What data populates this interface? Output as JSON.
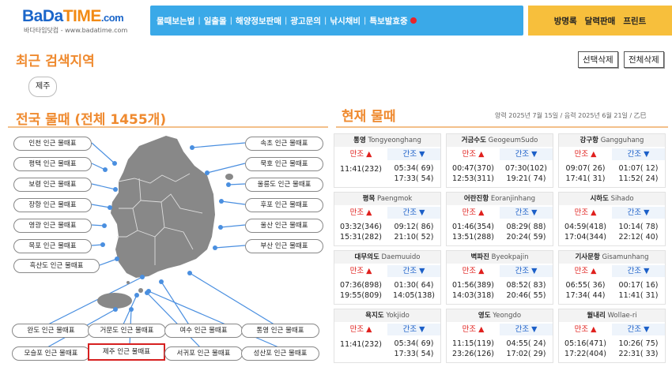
{
  "header": {
    "logo_main_a": "BaDa",
    "logo_main_b": "TIME",
    "logo_main_c": ".com",
    "logo_sub": "바다타임닷컴 - www.badatime.com",
    "nav": [
      "물때보는법",
      "일출몰",
      "해양정보판매",
      "광고문의",
      "낚시채비",
      "특보발효중"
    ],
    "right_links": [
      "방명록",
      "달력판매",
      "프린트"
    ],
    "colors": {
      "nav_bg": "#3aa9e8",
      "right_bg": "#f7bf3c",
      "logo_blue": "#1b66c9",
      "logo_orange": "#f28a14"
    }
  },
  "recent": {
    "title": "최근 검색지역",
    "btn_select_delete": "선택삭제",
    "btn_all_delete": "전체삭제",
    "chip": "제주"
  },
  "national": {
    "title": "전국 물때 (전체 1455개)",
    "left_buttons": [
      "인천 인근 물때표",
      "평택 인근 물때표",
      "보령 인근 물때표",
      "장항 인근 물때표",
      "영광 인근 물때표",
      "목포 인근 물때표",
      "흑산도 인근 물때표"
    ],
    "right_buttons": [
      "속초 인근 물때표",
      "묵호 인근 물때표",
      "울릉도 인근 물때표",
      "후포 인근 물때표",
      "울산 인근 물때표",
      "부산 인근 물때표"
    ],
    "bottom_row1": [
      "완도 인근 물때표",
      "거문도 인근 물때표",
      "여수 인근 물때표",
      "통영 인근 물때표"
    ],
    "bottom_row2": [
      "모슬포 인근 물때표",
      "제주 인근 물때표",
      "서귀포 인근 물때표",
      "성산포 인근 물때표"
    ],
    "selected": "제주 인근 물때표"
  },
  "current": {
    "title": "현재 물때",
    "date": "양력 2025년 7월 15일 / 음력 2025년 6월 21일 / 乙巳",
    "high_label": "만조 ▲",
    "low_label": "간조 ▼",
    "stations": [
      {
        "ko": "통영",
        "en": "Tongyeonghang",
        "high": [
          "11:41(232)"
        ],
        "low": [
          "05:34( 69)",
          "17:33( 54)"
        ]
      },
      {
        "ko": "거금수도",
        "en": "GeogeumSudo",
        "high": [
          "00:47(370)",
          "12:53(311)"
        ],
        "low": [
          "07:30(102)",
          "19:21( 74)"
        ]
      },
      {
        "ko": "강구항",
        "en": "Gangguhang",
        "high": [
          "09:07( 26)",
          "17:41( 31)"
        ],
        "low": [
          "01:07( 12)",
          "11:52( 24)"
        ]
      },
      {
        "ko": "평목",
        "en": "Paengmok",
        "high": [
          "03:32(346)",
          "15:31(282)"
        ],
        "low": [
          "09:12( 86)",
          "21:10( 52)"
        ]
      },
      {
        "ko": "어란진항",
        "en": "Eoranjinhang",
        "high": [
          "01:46(354)",
          "13:51(288)"
        ],
        "low": [
          "08:29( 88)",
          "20:24( 59)"
        ]
      },
      {
        "ko": "시하도",
        "en": "Sihado",
        "high": [
          "04:59(418)",
          "17:04(344)"
        ],
        "low": [
          "10:14( 78)",
          "22:12( 40)"
        ]
      },
      {
        "ko": "대무의도",
        "en": "Daemuuido",
        "high": [
          "07:36(898)",
          "19:55(809)"
        ],
        "low": [
          "01:30( 64)",
          "14:05(138)"
        ]
      },
      {
        "ko": "벽파진",
        "en": "Byeokpajin",
        "high": [
          "01:56(389)",
          "14:03(318)"
        ],
        "low": [
          "08:52( 83)",
          "20:46( 55)"
        ]
      },
      {
        "ko": "기사문항",
        "en": "Gisamunhang",
        "high": [
          "06:55( 36)",
          "17:34( 44)"
        ],
        "low": [
          "00:17( 16)",
          "11:41( 31)"
        ]
      },
      {
        "ko": "욕지도",
        "en": "Yokjido",
        "high": [
          "11:41(232)"
        ],
        "low": [
          "05:34( 69)",
          "17:33( 54)"
        ]
      },
      {
        "ko": "영도",
        "en": "Yeongdo",
        "high": [
          "11:15(119)",
          "23:26(126)"
        ],
        "low": [
          "04:55( 24)",
          "17:02( 29)"
        ]
      },
      {
        "ko": "월내리",
        "en": "Wollae-ri",
        "high": [
          "05:16(471)",
          "17:22(404)"
        ],
        "low": [
          "10:26( 75)",
          "22:31( 33)"
        ]
      }
    ]
  }
}
